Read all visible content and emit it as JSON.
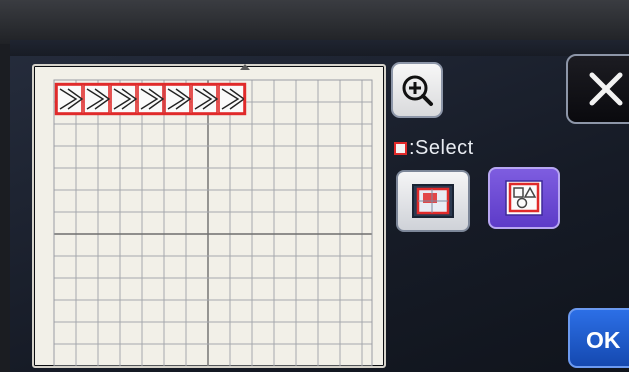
{
  "toolbar": {
    "zoom_icon": "zoom-in-magnifier-icon",
    "close_icon": "close-x-icon",
    "select_label": ":Select",
    "ok_label": "OK"
  },
  "pattern": {
    "motif": "chevron-arrow",
    "count": 7,
    "selection_color": "#e02a2a"
  },
  "colors": {
    "accent_purple": "#6a49d6",
    "ok_blue": "#1f5fd6",
    "grid_bg": "#f2f0e8",
    "selection_red": "#e02a2a"
  }
}
